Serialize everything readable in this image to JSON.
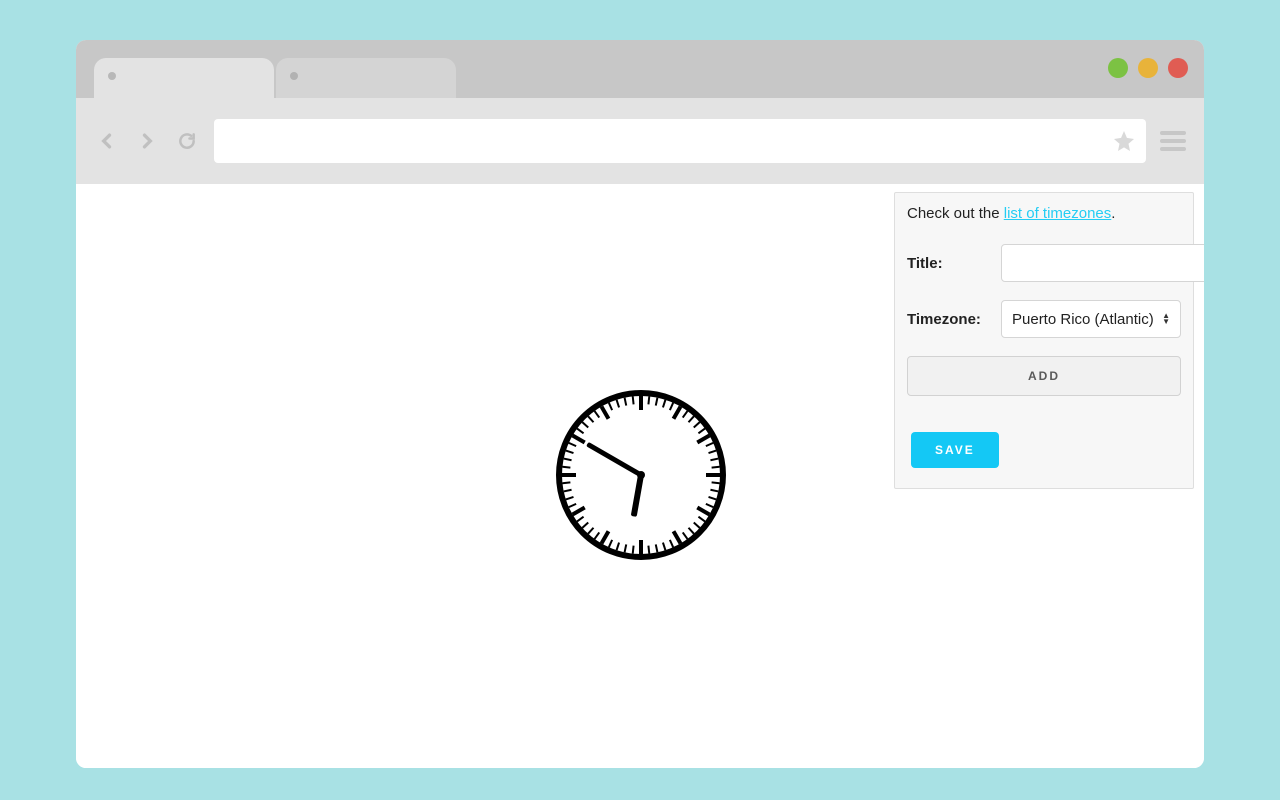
{
  "browser": {
    "tabs": [
      {
        "active": true
      },
      {
        "active": false
      }
    ]
  },
  "panel": {
    "intro_prefix": "Check out the ",
    "intro_link": "list of timezones",
    "intro_suffix": ".",
    "title_label": "Title:",
    "title_value": "",
    "timezone_label": "Timezone:",
    "timezone_selected": "Puerto Rico (Atlantic)",
    "add_button": "ADD",
    "save_button": "SAVE"
  },
  "clock": {
    "hour_angle": 190,
    "minute_angle": 300
  }
}
